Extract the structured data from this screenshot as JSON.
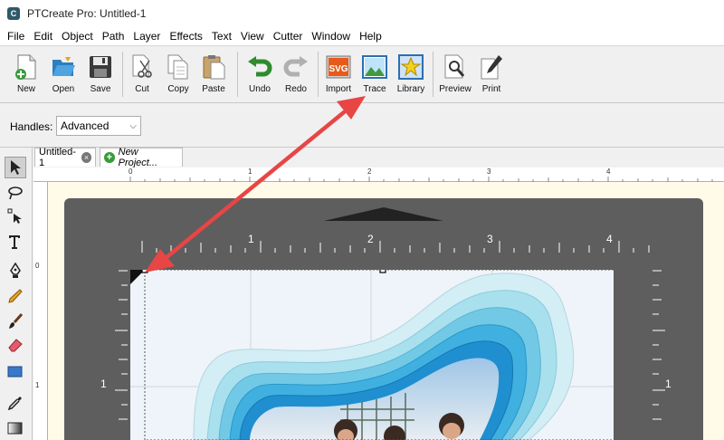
{
  "window": {
    "title": "PTCreate Pro: Untitled-1",
    "logo_letter": "C"
  },
  "menu": [
    "File",
    "Edit",
    "Object",
    "Path",
    "Layer",
    "Effects",
    "Text",
    "View",
    "Cutter",
    "Window",
    "Help"
  ],
  "toolbar": {
    "new": "New",
    "open": "Open",
    "save": "Save",
    "cut": "Cut",
    "copy": "Copy",
    "paste": "Paste",
    "undo": "Undo",
    "redo": "Redo",
    "import": "Import",
    "import_badge": "SVG",
    "trace": "Trace",
    "library": "Library",
    "preview": "Preview",
    "print": "Print"
  },
  "handles": {
    "label": "Handles:",
    "value": "Advanced"
  },
  "tabs": {
    "active": "Untitled-1",
    "close_glyph": "×",
    "new_glyph": "+",
    "new_project": "New Project..."
  },
  "ruler": {
    "h": [
      "0",
      "1",
      "2",
      "3",
      "4"
    ],
    "v": [
      "0",
      "1"
    ]
  },
  "mat": {
    "top": [
      "1",
      "2",
      "3",
      "4"
    ],
    "left": "1",
    "right": "1"
  },
  "colors": {
    "arrow": "#e84545",
    "mat": "#5e5e5e",
    "canvas_bg": "#fffbe8"
  }
}
